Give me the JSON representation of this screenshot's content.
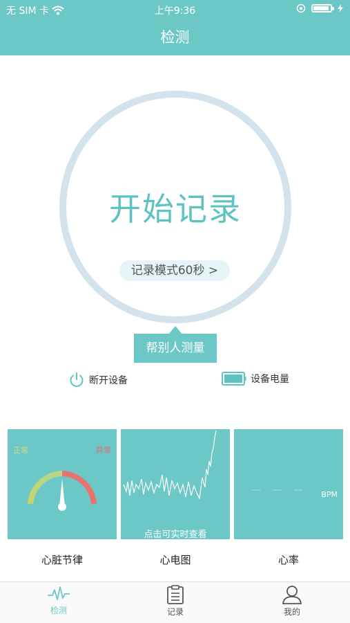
{
  "status_bar": {
    "carrier": "无 SIM 卡",
    "time": "上午9:36"
  },
  "header": {
    "title": "检测"
  },
  "main": {
    "start_button": "开始记录",
    "mode_selector": "记录模式60秒 >",
    "help_other": "帮别人测量"
  },
  "device": {
    "disconnect_label": "断开设备",
    "battery_label": "设备电量"
  },
  "cards": {
    "rhythm": {
      "normal": "正常",
      "abnormal": "异常",
      "label": "心脏节律"
    },
    "ecg": {
      "hint": "点击可实时查看",
      "label": "心电图"
    },
    "heart_rate": {
      "value": "— — —",
      "unit": "BPM",
      "label": "心率"
    }
  },
  "tabbar": {
    "items": [
      {
        "label": "检测",
        "icon": "pulse-icon",
        "active": true
      },
      {
        "label": "记录",
        "icon": "clipboard-icon",
        "active": false
      },
      {
        "label": "我的",
        "icon": "user-icon",
        "active": false
      }
    ]
  },
  "colors": {
    "primary": "#6cc8c7",
    "ring": "#d2e3ec",
    "tab_active": "#6cc8c7",
    "tab_inactive": "#555555"
  }
}
